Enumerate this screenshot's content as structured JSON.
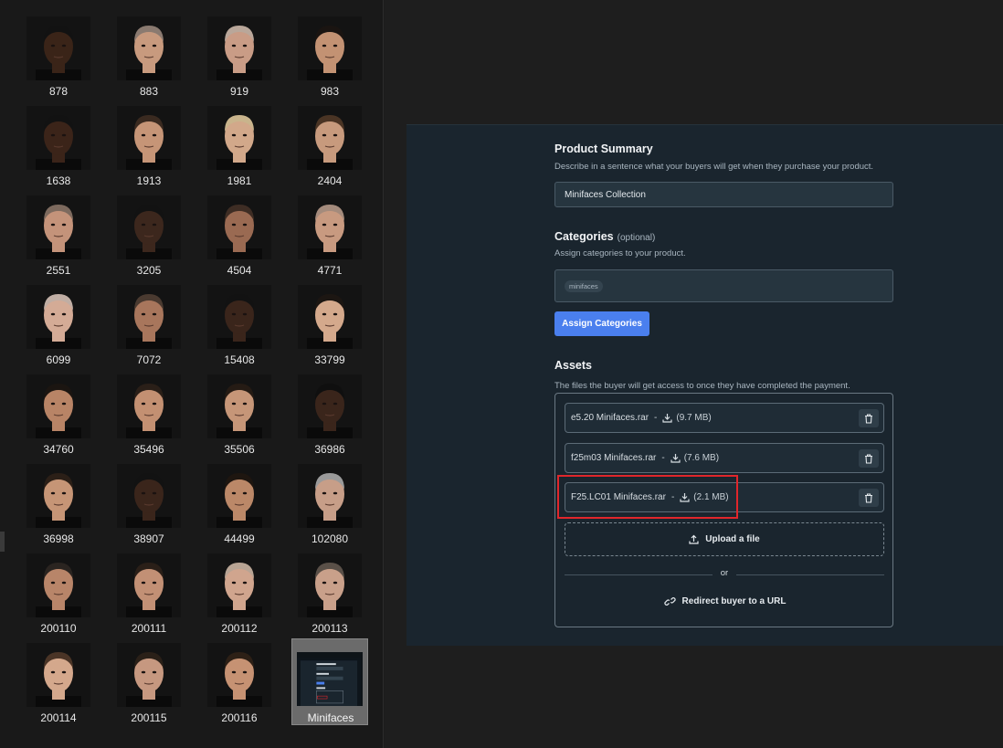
{
  "explorer": {
    "items": [
      {
        "label": "878",
        "skin": "#3a2418",
        "hair": "#121212"
      },
      {
        "label": "883",
        "skin": "#c89a7e",
        "hair": "#8a7a70"
      },
      {
        "label": "919",
        "skin": "#c99c86",
        "hair": "#b9a79a"
      },
      {
        "label": "983",
        "skin": "#c39273",
        "hair": "#1a1411"
      },
      {
        "label": "1638",
        "skin": "#3b2419",
        "hair": "#121212"
      },
      {
        "label": "1913",
        "skin": "#c69577",
        "hair": "#3a2a20"
      },
      {
        "label": "1981",
        "skin": "#d2a88a",
        "hair": "#c9b48c"
      },
      {
        "label": "2404",
        "skin": "#c79a7d",
        "hair": "#4a3424"
      },
      {
        "label": "2551",
        "skin": "#c4937a",
        "hair": "#7d6a5e"
      },
      {
        "label": "3205",
        "skin": "#3c271d",
        "hair": "#121212"
      },
      {
        "label": "4504",
        "skin": "#9a6a52",
        "hair": "#3e2d24"
      },
      {
        "label": "4771",
        "skin": "#c89a80",
        "hair": "#a48b7c"
      },
      {
        "label": "6099",
        "skin": "#d4ab96",
        "hair": "#c0aea4"
      },
      {
        "label": "7072",
        "skin": "#a8765c",
        "hair": "#4a3a30"
      },
      {
        "label": "15408",
        "skin": "#3a251b",
        "hair": "#121212"
      },
      {
        "label": "33799",
        "skin": "#d4a98c",
        "hair": "#1c1612"
      },
      {
        "label": "34760",
        "skin": "#b88466",
        "hair": "#1b1511"
      },
      {
        "label": "35496",
        "skin": "#c39072",
        "hair": "#2a1f18"
      },
      {
        "label": "35506",
        "skin": "#c69678",
        "hair": "#251b14"
      },
      {
        "label": "36986",
        "skin": "#3a251b",
        "hair": "#0f0f0f"
      },
      {
        "label": "36998",
        "skin": "#c69576",
        "hair": "#2b1f17"
      },
      {
        "label": "38907",
        "skin": "#3a251b",
        "hair": "#121212"
      },
      {
        "label": "44499",
        "skin": "#bb8868",
        "hair": "#1e1610"
      },
      {
        "label": "102080",
        "skin": "#c79e88",
        "hair": "#9a9a9a"
      },
      {
        "label": "200110",
        "skin": "#b88569",
        "hair": "#2a2420"
      },
      {
        "label": "200111",
        "skin": "#c29075",
        "hair": "#2a1f18"
      },
      {
        "label": "200112",
        "skin": "#d0a58e",
        "hair": "#b8a494"
      },
      {
        "label": "200113",
        "skin": "#c9a08a",
        "hair": "#5a5048"
      },
      {
        "label": "200114",
        "skin": "#d4a88c",
        "hair": "#4a3426"
      },
      {
        "label": "200115",
        "skin": "#c69880",
        "hair": "#2a2018"
      },
      {
        "label": "200116",
        "skin": "#c69273",
        "hair": "#2d2016"
      }
    ],
    "selected": {
      "label": "Minifaces"
    }
  },
  "product": {
    "summary_title": "Product Summary",
    "summary_desc": "Describe in a sentence what your buyers will get when they purchase your product.",
    "summary_value": "Minifaces Collection",
    "categories_title": "Categories",
    "categories_optional": "(optional)",
    "categories_desc": "Assign categories to your product.",
    "category_chip": "minifaces",
    "assign_button": "Assign Categories",
    "assets_title": "Assets",
    "assets_desc": "The files the buyer will get access to once they have completed the payment.",
    "files": [
      {
        "name": "e5.20 Minifaces.rar",
        "sep": "-",
        "size": "(9.7 MB)"
      },
      {
        "name": "f25m03 Minifaces.rar",
        "sep": "-",
        "size": "(7.6 MB)"
      },
      {
        "name": "F25.LC01 Minifaces.rar",
        "sep": "-",
        "size": "(2.1 MB)"
      }
    ],
    "upload_label": "Upload a file",
    "or_label": "or",
    "redirect_label": "Redirect buyer to a URL"
  },
  "colors": {
    "accent": "#4a7fee",
    "highlight": "#e0262b",
    "panel_bg": "#1a252e"
  }
}
